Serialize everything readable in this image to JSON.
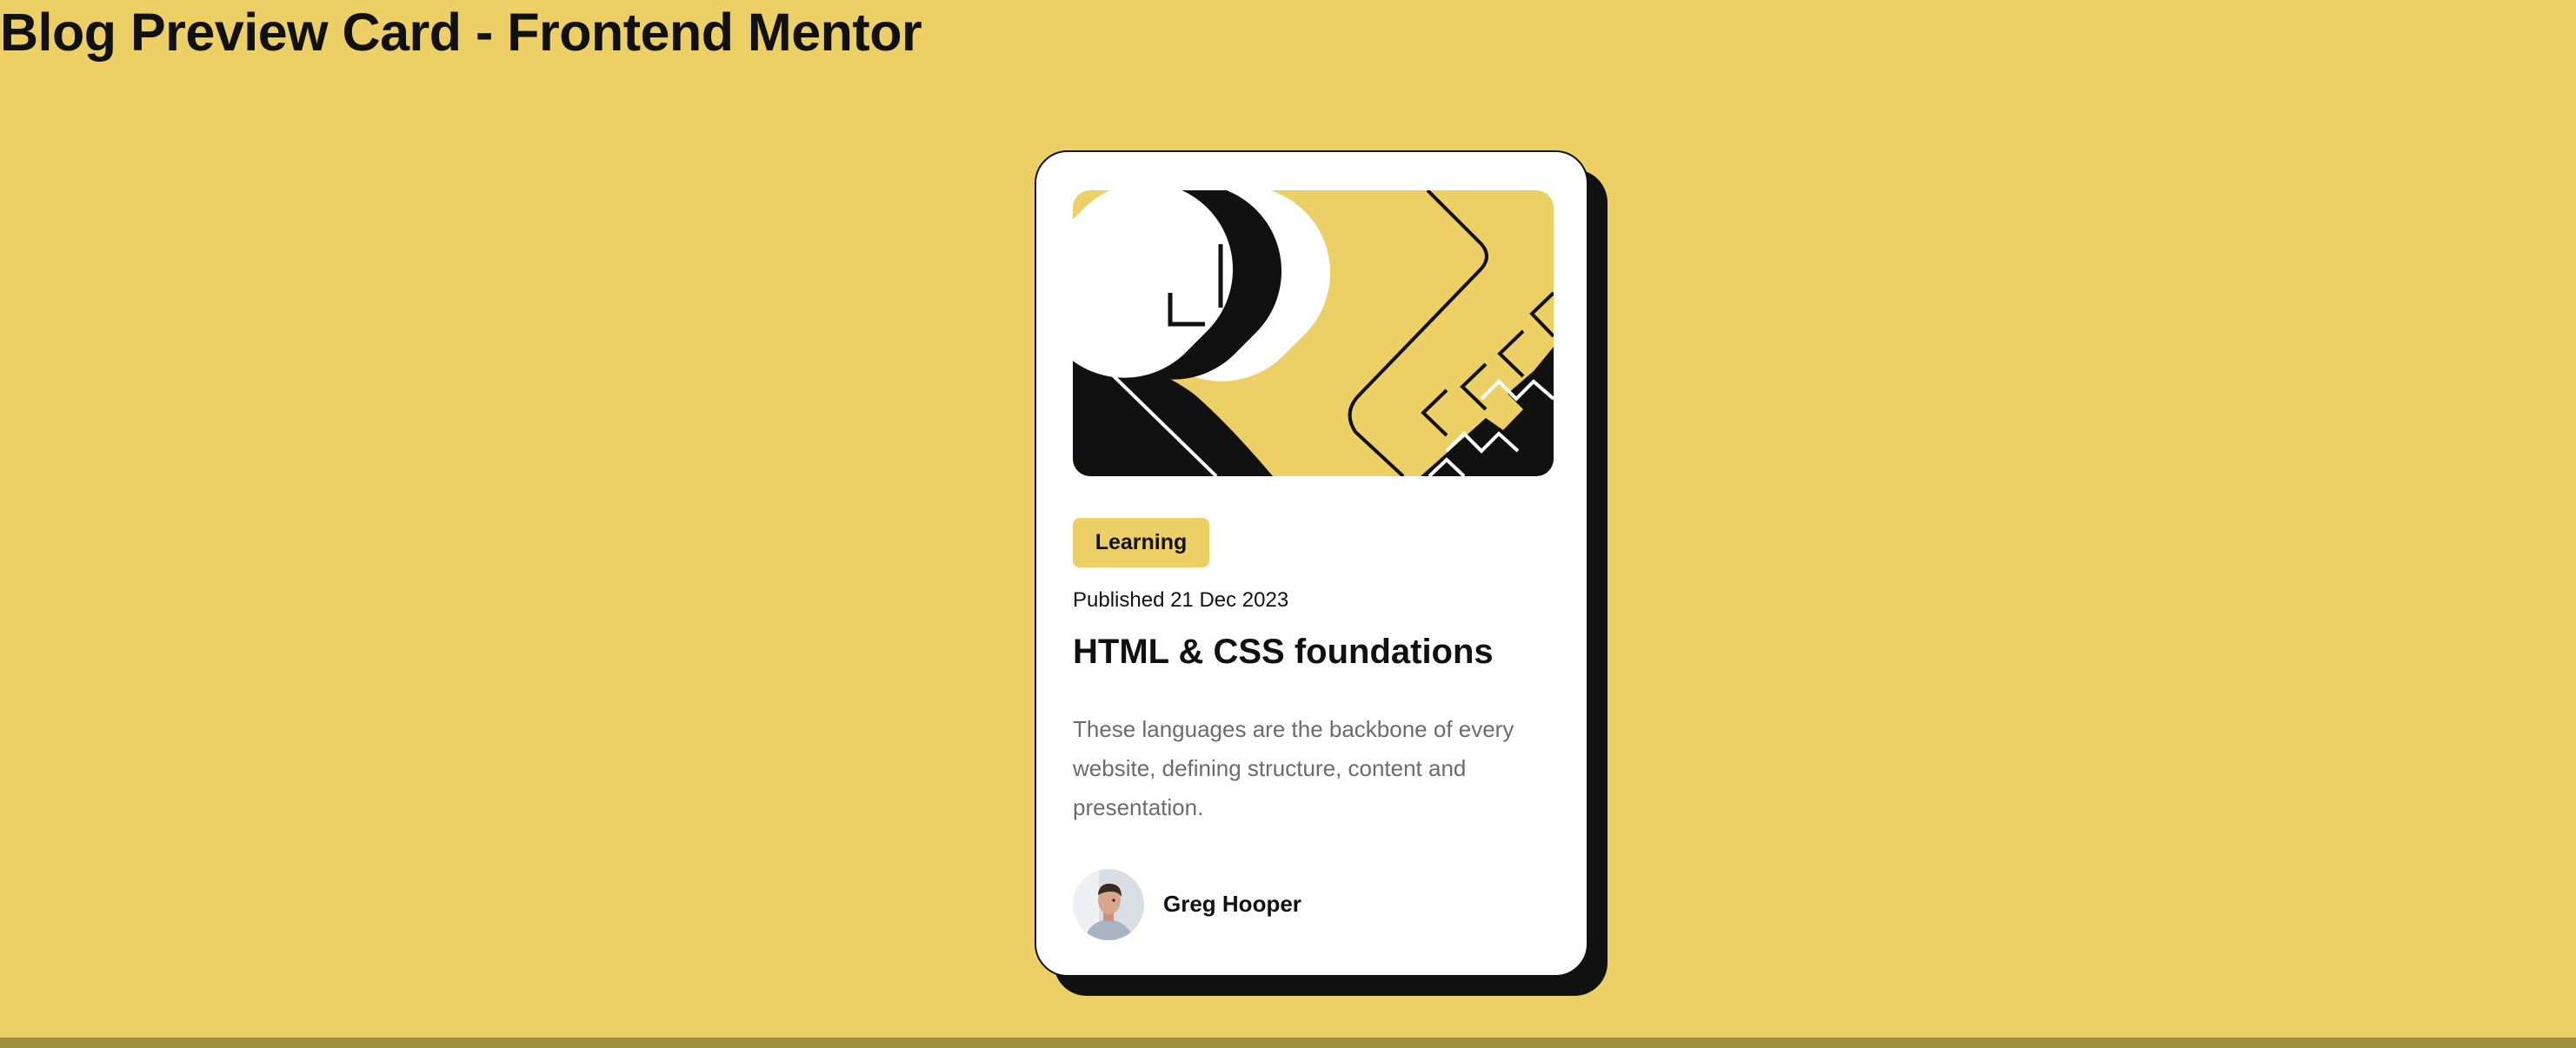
{
  "page": {
    "title": "Blog Preview Card - Frontend Mentor"
  },
  "card": {
    "image_icon": "html-css-illustration",
    "tag": "Learning",
    "published": "Published 21 Dec 2023",
    "title": "HTML & CSS foundations",
    "excerpt": "These languages are the backbone of every website, defining structure, content and presentation.",
    "author": {
      "avatar_icon": "author-avatar-image",
      "name": "Greg Hooper"
    }
  },
  "colors": {
    "background": "#ECD066",
    "card": "#FFFFFF",
    "text": "#111111",
    "muted_text": "#6B6B6B",
    "shadow": "#111111"
  }
}
